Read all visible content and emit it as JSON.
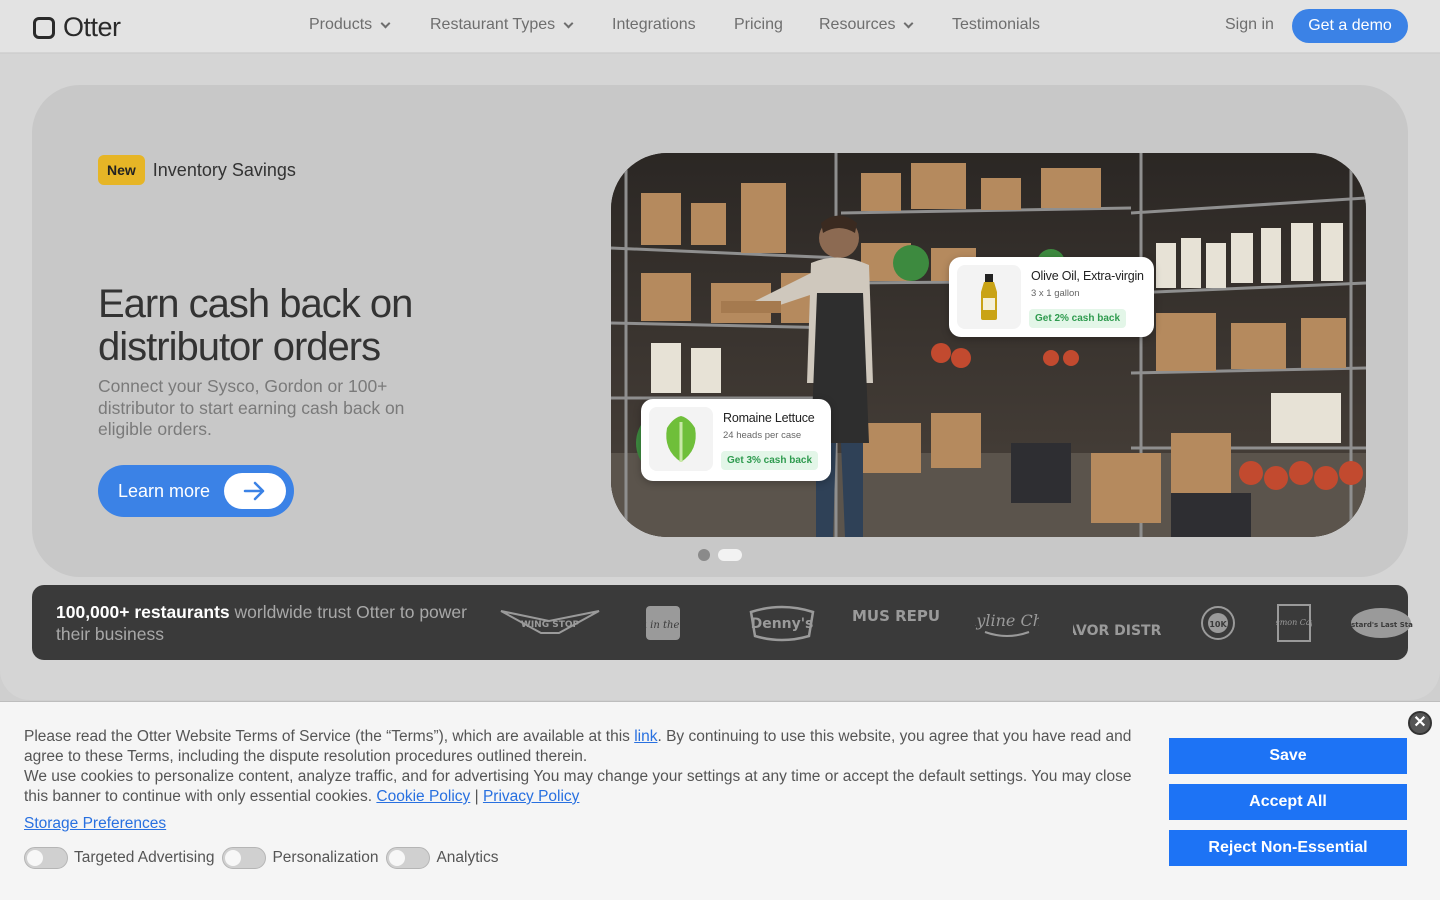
{
  "header": {
    "logo_text": "Otter",
    "nav": [
      {
        "label": "Products",
        "dropdown": true
      },
      {
        "label": "Restaurant Types",
        "dropdown": true
      },
      {
        "label": "Integrations",
        "dropdown": false
      },
      {
        "label": "Pricing",
        "dropdown": false
      },
      {
        "label": "Resources",
        "dropdown": true
      },
      {
        "label": "Testimonials",
        "dropdown": false
      }
    ],
    "sign_in": "Sign in",
    "cta": "Get a demo"
  },
  "hero": {
    "badge": "New",
    "badge_label": "Inventory Savings",
    "title": "Earn cash back on distributor orders",
    "subtitle": "Connect your Sysco, Gordon or 100+ distributor to start earning cash back on eligible orders.",
    "button": "Learn more",
    "slides_total": 2,
    "active_slide": 2,
    "cards": [
      {
        "name": "Olive Oil, Extra-virgin",
        "qty": "3 x 1 gallon",
        "cashback": "Get 2% cash back"
      },
      {
        "name": "Romaine Lettuce",
        "qty": "24 heads per case",
        "cashback": "Get 3% cash back"
      }
    ]
  },
  "trust": {
    "strong": "100,000+ restaurants",
    "rest": " worldwide trust Otter to power their business",
    "brands": [
      "WING STOP",
      "Jack in the box",
      "Denny's",
      "HUMMUS REPUBLIC",
      "Skyline Chili",
      "FLAVOR DISTRICT",
      "10K",
      "Lemon Cafe",
      "Mustard's Last Stand"
    ]
  },
  "cookie": {
    "p1_before": "Please read the Otter Website Terms of Service (the “Terms”), which are available at this ",
    "p1_link": "link",
    "p1_after": ". By continuing to use this website, you agree that you have read and agree to these Terms, including the dispute resolution procedures outlined therein.",
    "p2": "We use cookies to personalize content, analyze traffic, and for advertising You may change your settings at any time or accept the default settings. You may close this banner to continue with only essential cookies. ",
    "cookie_policy": "Cookie Policy",
    "separator": " | ",
    "privacy_policy": "Privacy Policy",
    "storage_preferences": "Storage Preferences",
    "toggles": [
      "Targeted Advertising",
      "Personalization",
      "Analytics"
    ],
    "buttons": {
      "save": "Save",
      "accept": "Accept All",
      "reject": "Reject Non-Essential"
    },
    "close": "✕"
  },
  "colors": {
    "accent": "#3b82e6",
    "cookie_button": "#1d73f5",
    "badge": "#e6b526",
    "cashback": "#2f9b4f"
  }
}
